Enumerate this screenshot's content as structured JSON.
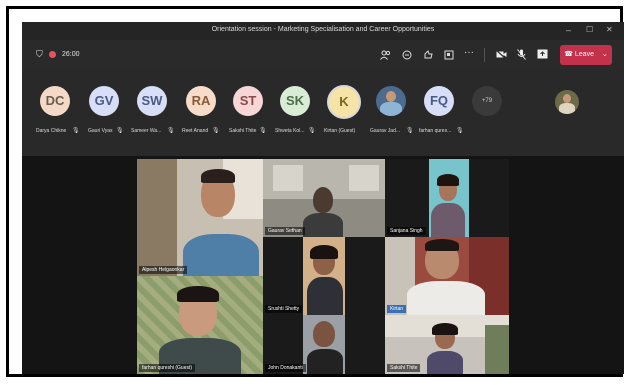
{
  "window": {
    "title": "Orientation session - Marketing Specialisation and Career Opportunities",
    "minimize": "–",
    "maximize": "☐",
    "close": "✕"
  },
  "toolbar": {
    "timer": "26:00",
    "leave_label": "Leave",
    "icons": [
      "shield-icon",
      "record-icon",
      "people-icon",
      "chat-icon",
      "reactions-icon",
      "rooms-icon",
      "more-icon",
      "camera-icon",
      "mic-icon",
      "share-icon"
    ]
  },
  "participants": [
    {
      "initials": "DC",
      "name": "Darya Chikne",
      "color": "#f3d9c6"
    },
    {
      "initials": "GV",
      "name": "Gauri Vyas",
      "color": "#d6dff7"
    },
    {
      "initials": "SW",
      "name": "Sameer Wa...",
      "color": "#d6dff7"
    },
    {
      "initials": "RA",
      "name": "Reet Anand",
      "color": "#f7dcc9"
    },
    {
      "initials": "ST",
      "name": "Sakshi Thite",
      "color": "#f7d6d6"
    },
    {
      "initials": "SK",
      "name": "Shweta Kol...",
      "color": "#d8ecd6"
    },
    {
      "initials": "K",
      "name": "Kirtan (Guest)",
      "color": "#f5e3a8"
    },
    {
      "initials": "",
      "name": "Gaurav Jad...",
      "color": "#4c6b8f"
    },
    {
      "initials": "FQ",
      "name": "farhan qures...",
      "color": "#d6dff7"
    },
    {
      "initials": "+79",
      "name": "",
      "color": "#3a3a3a"
    }
  ],
  "tiles": [
    {
      "label": "Alpesh Helgaonkar"
    },
    {
      "label": "Gaurav Sethan"
    },
    {
      "label": "Sanjana Singh"
    },
    {
      "label": "Srushti Shetty"
    },
    {
      "label": "Kirtan"
    },
    {
      "label": "farhan qureshi (Guest)"
    },
    {
      "label": "John Donakanti"
    },
    {
      "label": "Sakshi Thite"
    }
  ]
}
